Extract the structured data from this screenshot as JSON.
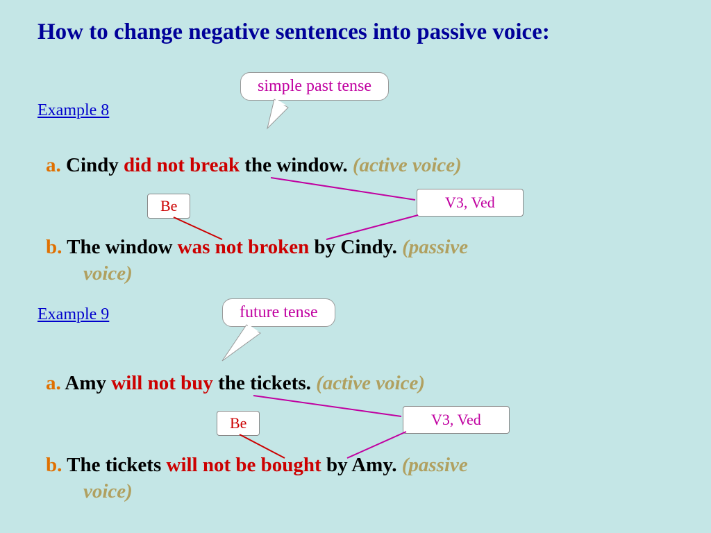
{
  "title": "How to change negative sentences into passive voice:",
  "ex8": {
    "label": "Example 8",
    "callout": "simple past tense",
    "a_prefix": "a.",
    "a_subj": "  Cindy ",
    "a_verb": "did not break",
    "a_obj": " the window.  ",
    "a_voice": "(active voice)",
    "be_box": "Be",
    "v3_box": "V3, Ved",
    "b_prefix": "b.",
    "b_subj": "  The window ",
    "b_verb": "was not broken",
    "b_by": " by Cindy.  ",
    "b_voice1": "(passive",
    "b_voice2": "voice)"
  },
  "ex9": {
    "label": "Example 9",
    "callout": "future tense",
    "a_prefix": "a.",
    "a_subj": "  Amy ",
    "a_verb": "will not buy",
    "a_obj": " the tickets.  ",
    "a_voice": "(active voice)",
    "be_box": "Be",
    "v3_box": "V3, Ved",
    "b_prefix": "b.",
    "b_subj": "  The tickets ",
    "b_verb": "will not be bought",
    "b_by": " by Amy.  ",
    "b_voice1": "(passive",
    "b_voice2": "voice)"
  }
}
